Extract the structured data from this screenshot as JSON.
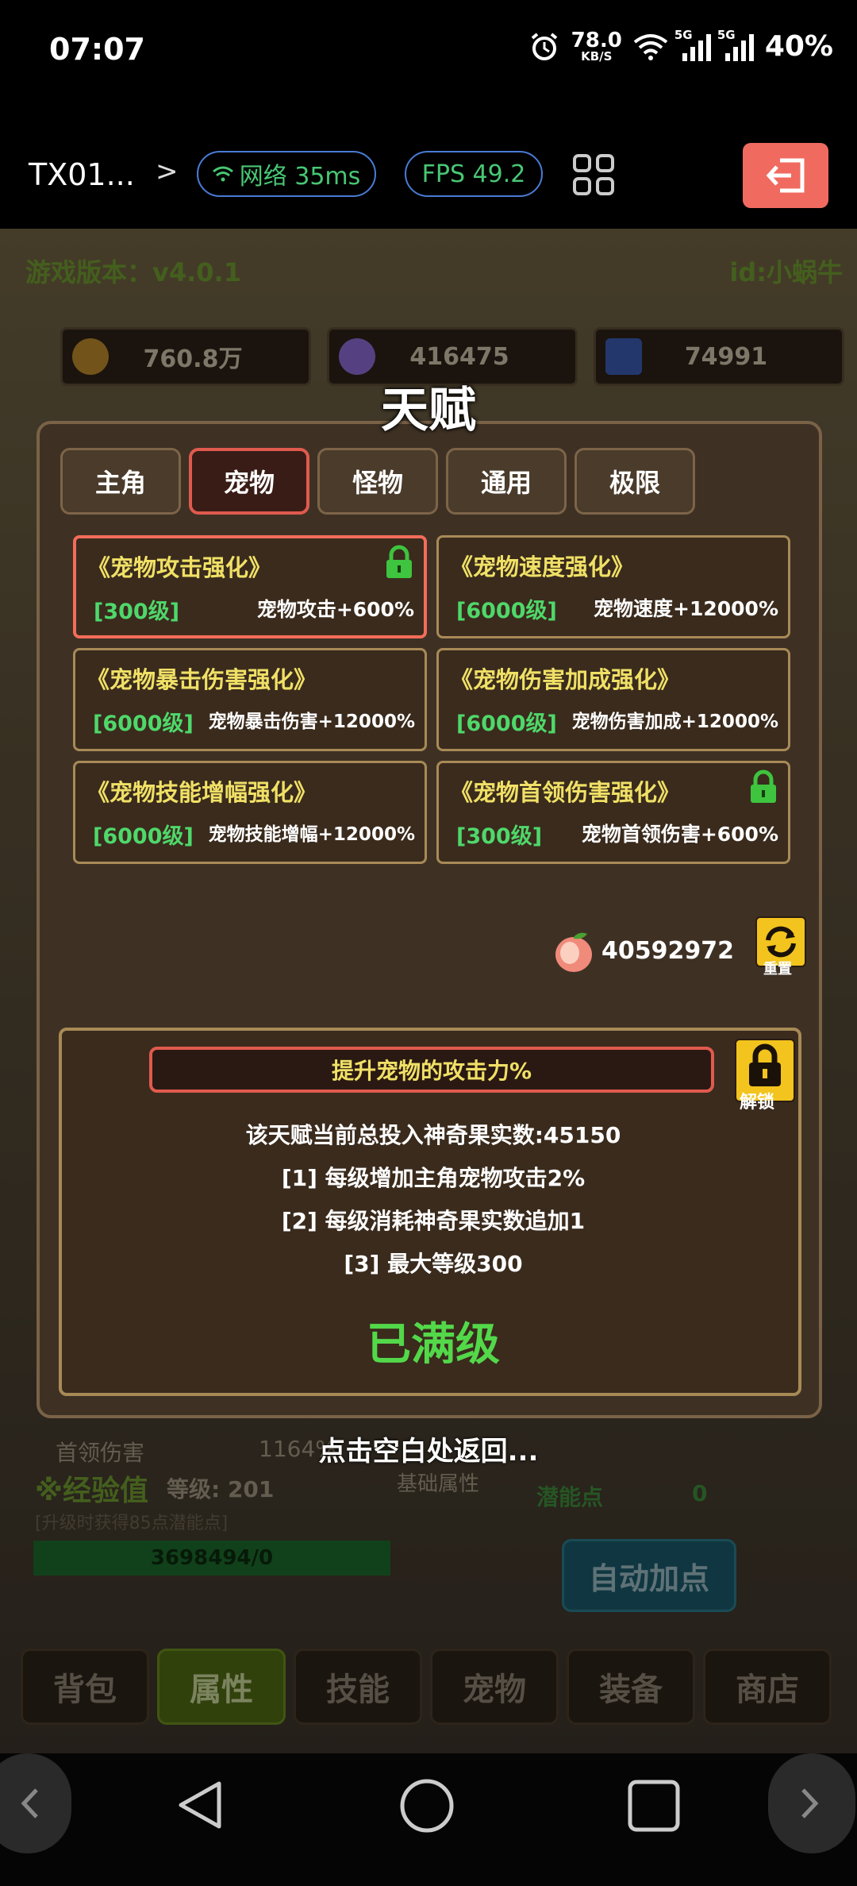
{
  "status_bar": {
    "time": "07:07",
    "net_speed_value": "78.0",
    "net_speed_unit": "KB/S",
    "sig1_tag": "5G",
    "sig2_tag": "5G",
    "battery": "40%"
  },
  "top_bar": {
    "title": "TX01...",
    "chevron": ">",
    "network_label": "网络 35ms",
    "fps_label": "FPS 49.2"
  },
  "game": {
    "version": "游戏版本：v4.0.1",
    "user_id": "id:小蜗牛",
    "resources": [
      {
        "icon": "coin-icon",
        "value": "760.8万"
      },
      {
        "icon": "crystal-icon",
        "value": "416475"
      },
      {
        "icon": "card-icon",
        "value": "74991"
      }
    ],
    "panel_title": "天赋",
    "tabs": [
      "主角",
      "宠物",
      "怪物",
      "通用",
      "极限"
    ],
    "active_tab": "宠物",
    "talents": [
      {
        "name": "《宠物攻击强化》",
        "level": "[300级]",
        "effect": "宠物攻击+600%",
        "locked": true,
        "selected": true
      },
      {
        "name": "《宠物速度强化》",
        "level": "[6000级]",
        "effect": "宠物速度+12000%",
        "locked": false,
        "selected": false
      },
      {
        "name": "《宠物暴击伤害强化》",
        "level": "[6000级]",
        "effect": "宠物暴击伤害+12000%",
        "locked": false,
        "selected": false
      },
      {
        "name": "《宠物伤害加成强化》",
        "level": "[6000级]",
        "effect": "宠物伤害加成+12000%",
        "locked": false,
        "selected": false
      },
      {
        "name": "《宠物技能增幅强化》",
        "level": "[6000级]",
        "effect": "宠物技能增幅+12000%",
        "locked": false,
        "selected": false
      },
      {
        "name": "《宠物首领伤害强化》",
        "level": "[300级]",
        "effect": "宠物首领伤害+600%",
        "locked": true,
        "selected": false
      }
    ],
    "fruit_count": "40592972",
    "reset_label": "重置",
    "detail": {
      "description": "提升宠物的攻击力%",
      "unlock_label": "解锁",
      "invested": "该天赋当前总投入神奇果实数:45150",
      "rule1": "[1] 每级增加主角宠物攻击2%",
      "rule2": "[2] 每级消耗神奇果实数追加1",
      "rule3": "[3] 最大等级300",
      "status": "已满级"
    },
    "background_ui": {
      "boss_damage_label": "首领伤害",
      "boss_damage_value": "1164%",
      "base_attr": "基础属性",
      "xp_label": "※经验值",
      "level_label": "等级: 201",
      "xp_hint": "[升级时获得85点潜能点]",
      "xp_value": "3698494/0",
      "potential_label": "潜能点",
      "potential_value": "0",
      "auto_add": "自动加点"
    },
    "back_hint": "点击空白处返回...",
    "bottom_nav": [
      "背包",
      "属性",
      "技能",
      "宠物",
      "装备",
      "商店"
    ],
    "bottom_nav_active": "属性"
  }
}
